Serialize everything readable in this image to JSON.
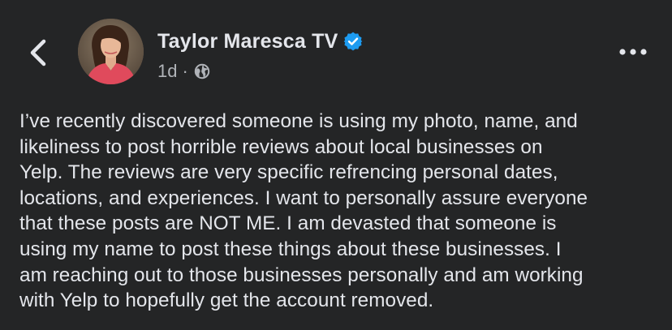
{
  "post": {
    "author": "Taylor Maresca TV",
    "verified": true,
    "timestamp": "1d",
    "separator": "·",
    "audience_icon": "globe-icon",
    "lines": [
      "I’ve recently discovered someone is using my photo, name, and",
      "likeliness to post horrible reviews about local businesses on",
      "Yelp. The reviews are very specific refrencing personal dates,",
      "locations, and experiences. I want to personally assure everyone",
      "that these posts are NOT ME. I am devasted that someone is",
      "using my name to post these things about these businesses. I",
      "am reaching out to those businesses personally and am working",
      "with Yelp to hopefully get the account removed."
    ]
  },
  "icons": {
    "back": "chevron-left-icon",
    "verified": "verified-badge-icon",
    "more": "more-options-icon"
  },
  "colors": {
    "background": "#242526",
    "primary_text": "#e4e6eb",
    "secondary_text": "#b0b3b8",
    "verified_blue": "#1d9bf0"
  }
}
